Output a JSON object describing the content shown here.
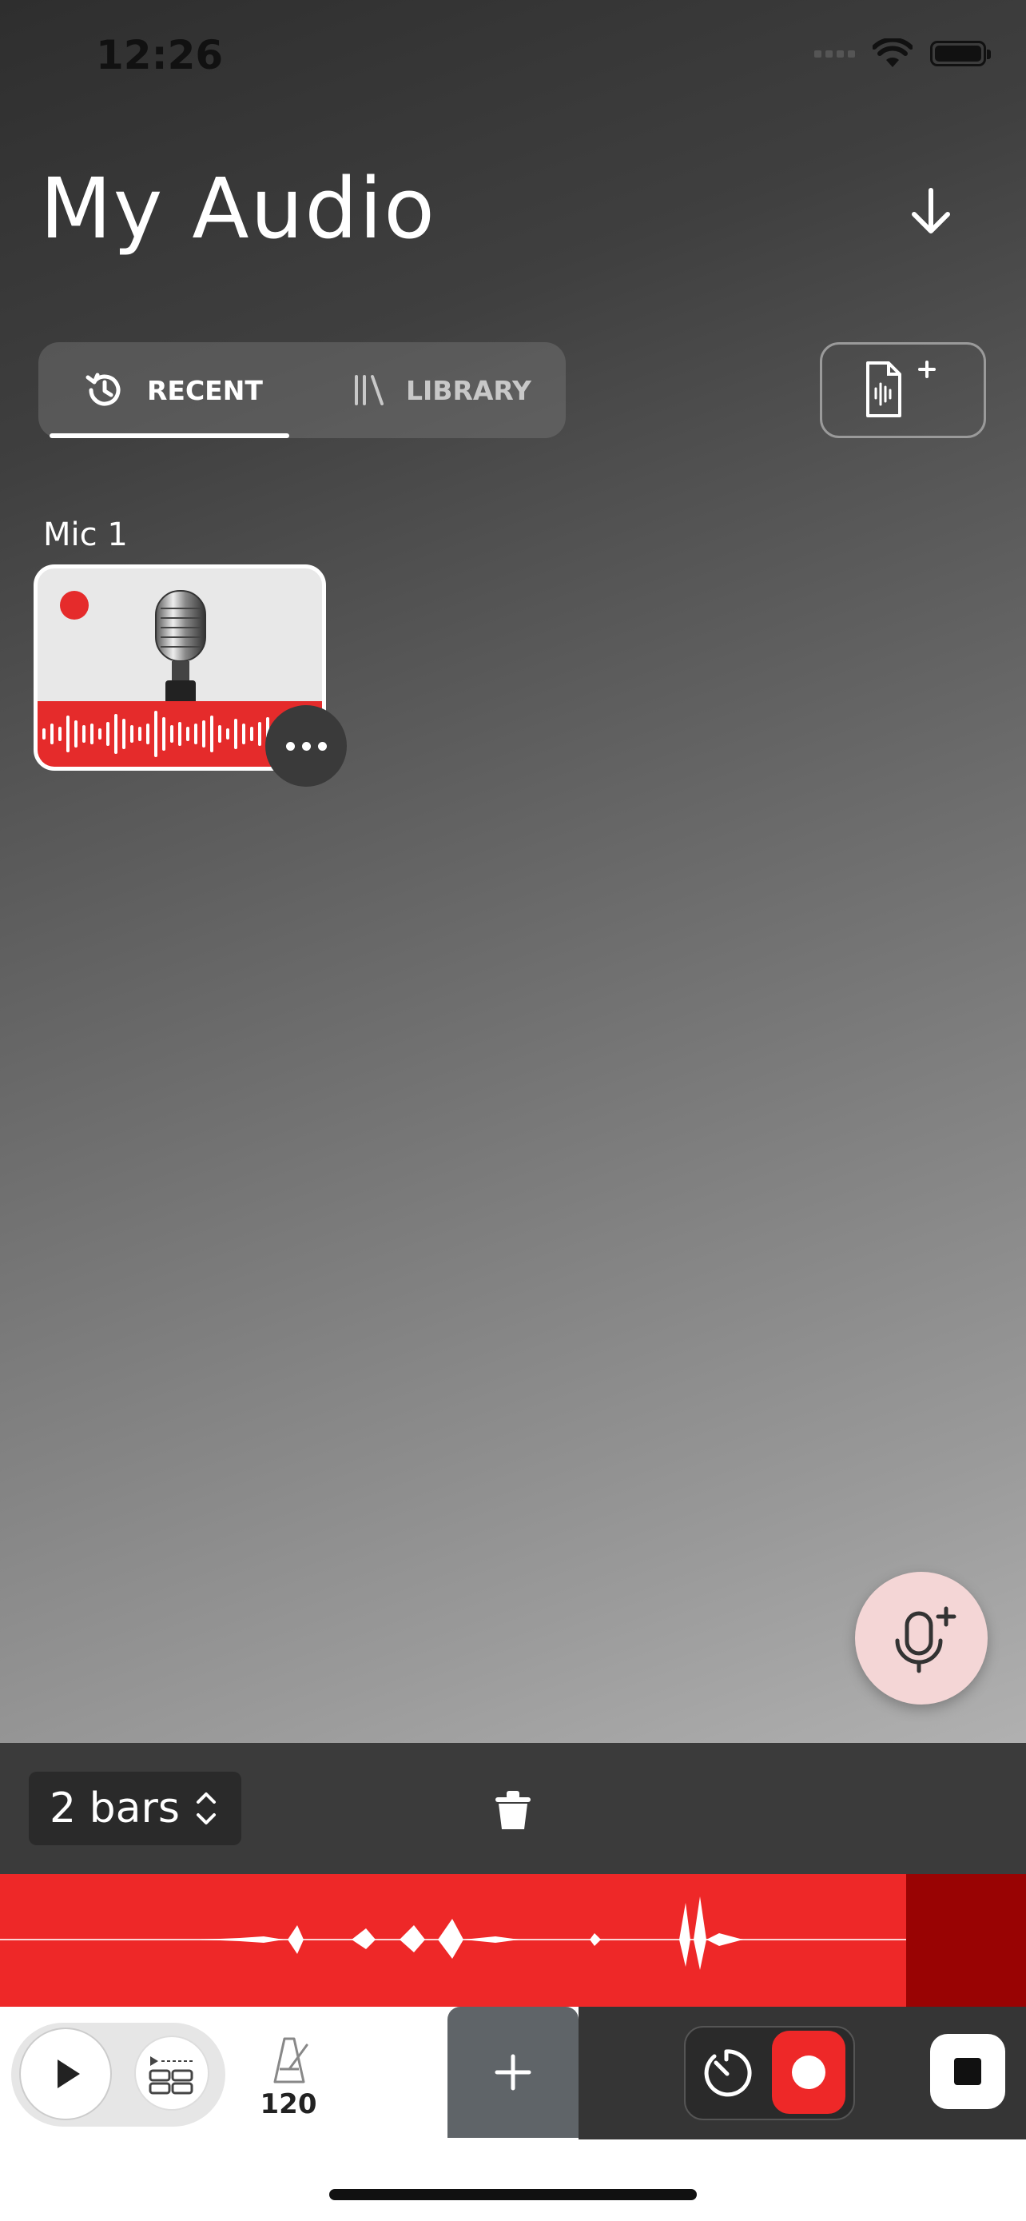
{
  "status_bar": {
    "time": "12:26"
  },
  "header": {
    "title": "My Audio"
  },
  "tabs": [
    {
      "label": "RECENT",
      "active": true
    },
    {
      "label": "LIBRARY",
      "active": false
    }
  ],
  "tracks": [
    {
      "name": "Mic 1"
    }
  ],
  "editor": {
    "length_label": "2 bars"
  },
  "toolbar": {
    "tempo": "120"
  },
  "colors": {
    "accent_red": "#ee2828",
    "dark_red": "#990303",
    "fab_pink": "#f4d6d6"
  },
  "icons": {
    "download": "arrow-down-icon",
    "recent": "history-icon",
    "library": "library-icon",
    "new_file": "new-audio-file-icon",
    "add_mic": "mic-plus-icon",
    "trash": "trash-icon",
    "play": "play-icon",
    "loop": "loop-grid-icon",
    "metronome": "metronome-icon",
    "add": "plus-icon",
    "timer": "timer-icon",
    "record": "record-icon",
    "stop": "stop-icon"
  }
}
